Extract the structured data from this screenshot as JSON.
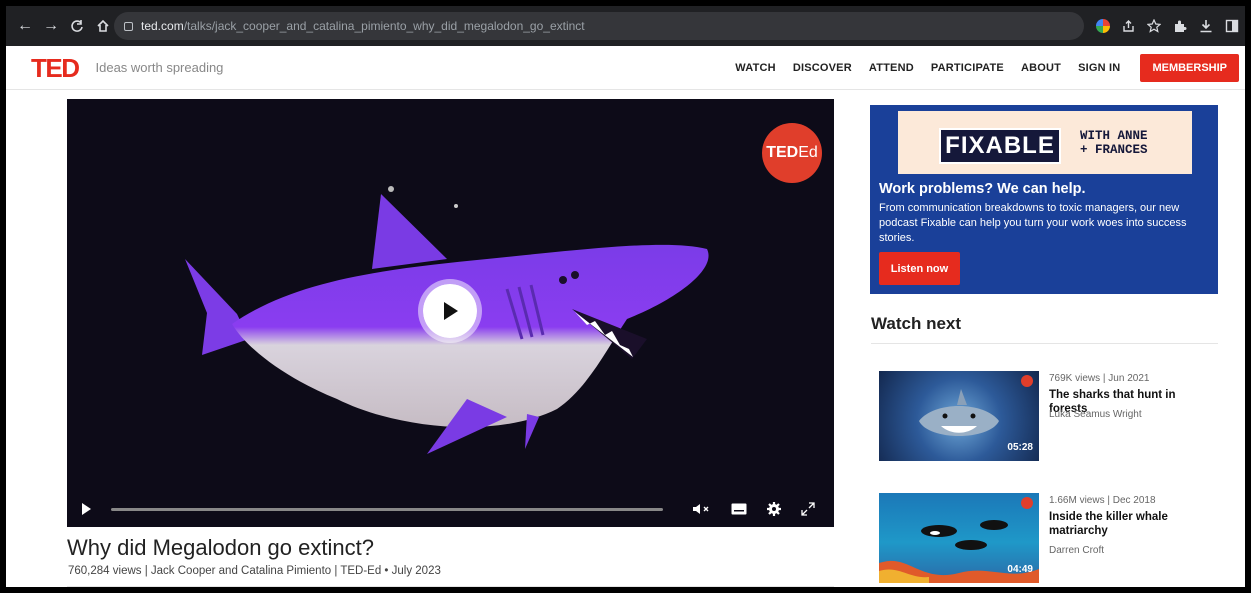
{
  "browser": {
    "back_icon": "←",
    "forward_icon": "→",
    "reload_icon": "C",
    "home_icon": "⌂",
    "url_domain": "ted.com",
    "url_path": "/talks/jack_cooper_and_catalina_pimiento_why_did_megalodon_go_extinct"
  },
  "header": {
    "logo": "TED",
    "tagline": "Ideas worth spreading",
    "nav": [
      "WATCH",
      "DISCOVER",
      "ATTEND",
      "PARTICIPATE",
      "ABOUT",
      "SIGN IN"
    ],
    "membership": "MEMBERSHIP",
    "accent_color": "#e62b1e"
  },
  "video": {
    "badge_bold": "TED",
    "badge_light": "Ed",
    "title": "Why did Megalodon go extinct?",
    "meta": "760,284 views | Jack Cooper and Catalina Pimiento | TED-Ed • July 2023"
  },
  "ad": {
    "logo": "FIXABLE",
    "with_line1": "WITH ANNE",
    "with_line2": "+ FRANCES",
    "headline": "Work problems? We can help.",
    "body": "From communication breakdowns to toxic managers, our new podcast Fixable can help you turn your work woes into success stories.",
    "button": "Listen now",
    "bg_color": "#1a4099"
  },
  "watch_next": {
    "heading": "Watch next",
    "items": [
      {
        "meta": "769K views | Jun 2021",
        "title": "The sharks that hunt in forests",
        "speaker": "Luka Seamus Wright",
        "duration": "05:28"
      },
      {
        "meta": "1.66M views | Dec 2018",
        "title": "Inside the killer whale matriarchy",
        "speaker": "Darren Croft",
        "duration": "04:49"
      }
    ]
  }
}
